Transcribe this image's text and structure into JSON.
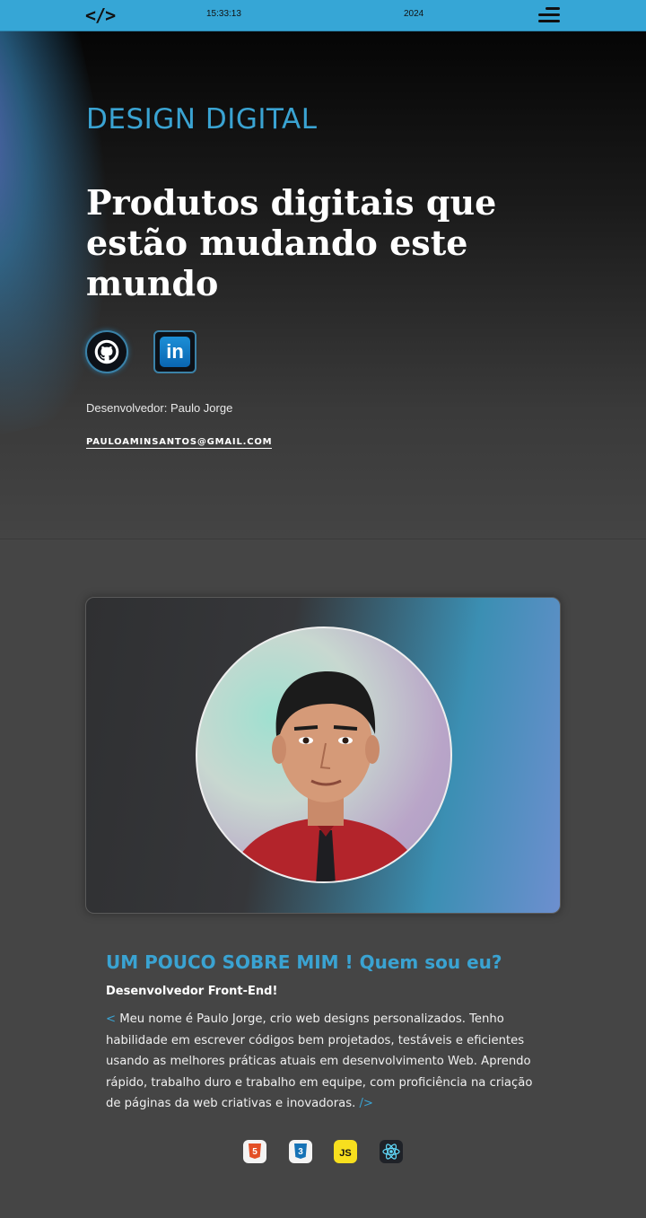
{
  "header": {
    "logo": "</>",
    "time": "15:33:13",
    "year": "2024"
  },
  "hero": {
    "kicker": "DESIGN DIGITAL",
    "title": "Produtos digitais que estão mudando este mundo",
    "social": [
      {
        "name": "GitHub",
        "icon": "github-icon"
      },
      {
        "name": "LinkedIn",
        "icon": "linkedin-icon",
        "glyph": "in"
      }
    ],
    "developer": "Desenvolvedor: Paulo Jorge",
    "email": "PAULOAMINSANTOS@GMAIL.COM"
  },
  "about": {
    "title": "UM POUCO SOBRE MIM ! Quem sou eu?",
    "subtitle": "Desenvolvedor Front-End!",
    "open_tag": "<",
    "text": " Meu nome é Paulo Jorge, crio web designs personalizados. Tenho habilidade em escrever códigos bem projetados, testáveis e eficientes usando as melhores práticas atuais em desenvolvimento Web. Aprendo rápido, trabalho duro e trabalho em equipe, com proficiência na criação de páginas da web criativas e inovadoras. ",
    "close_tag": "/>",
    "tech": [
      {
        "icon": "html5-icon",
        "glyph": "5"
      },
      {
        "icon": "css3-icon",
        "glyph": "3"
      },
      {
        "icon": "javascript-icon",
        "glyph": "JS"
      },
      {
        "icon": "react-icon"
      }
    ]
  },
  "colors": {
    "accent": "#3aa3d2",
    "topbar": "#36a6d6",
    "background": "#454545"
  }
}
